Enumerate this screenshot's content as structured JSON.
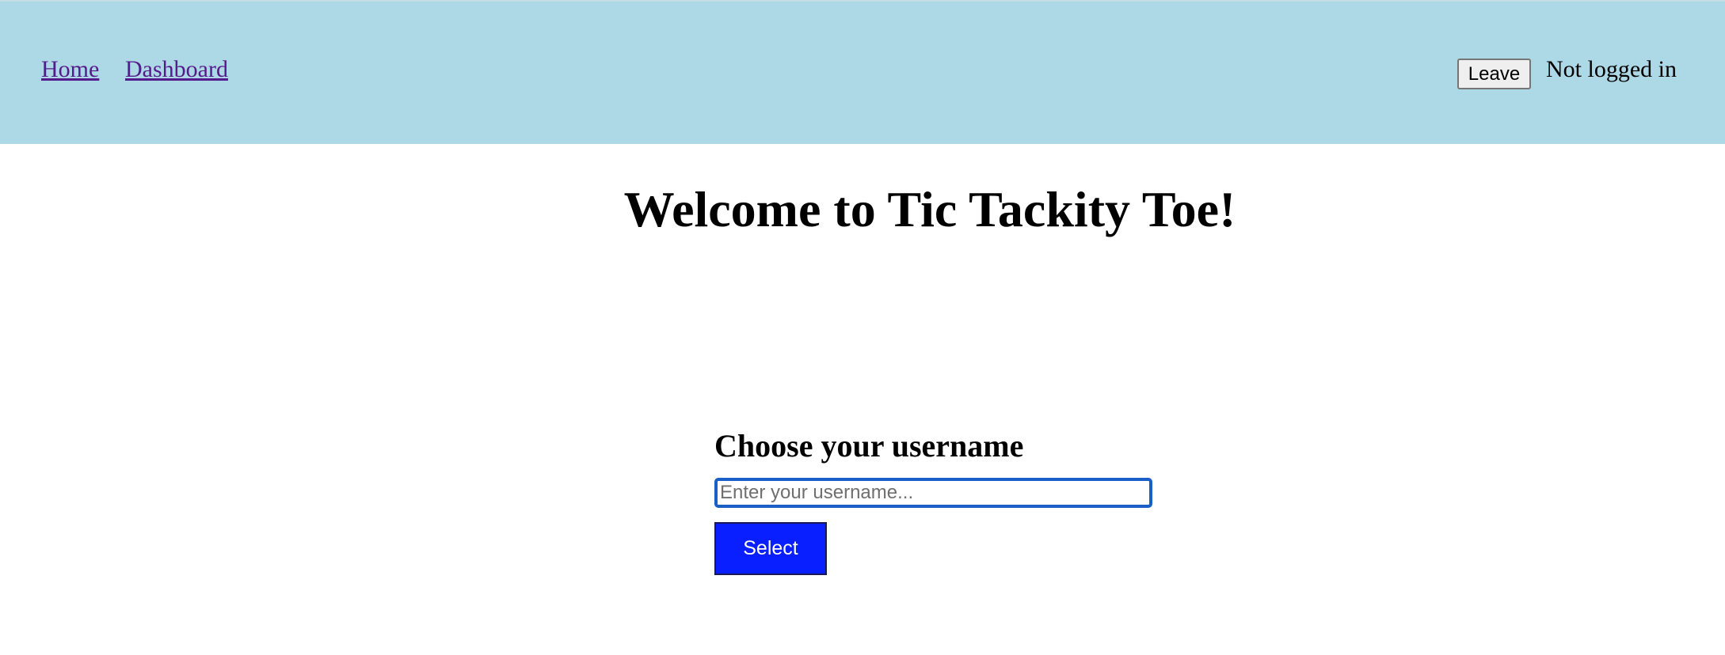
{
  "nav": {
    "links": [
      {
        "label": "Home"
      },
      {
        "label": "Dashboard"
      }
    ]
  },
  "header": {
    "leave_label": "Leave",
    "status_text": "Not logged in"
  },
  "main": {
    "title": "Welcome to Tic Tackity Toe!",
    "form": {
      "heading": "Choose your username",
      "input_placeholder": "Enter your username...",
      "input_value": "",
      "select_label": "Select"
    }
  },
  "colors": {
    "topbar_background": "#add8e6",
    "link": "#551a8b",
    "select_button": "#0a1fff",
    "input_focus_border": "#1a5fc8"
  }
}
